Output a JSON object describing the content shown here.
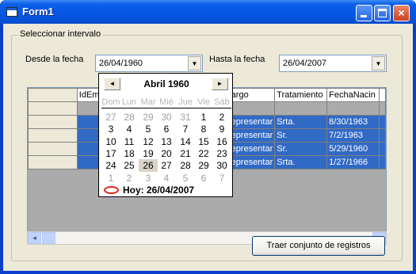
{
  "window": {
    "title": "Form1",
    "minimize": "_",
    "maximize": "□",
    "close": "×"
  },
  "group": {
    "legend": "Seleccionar intervalo"
  },
  "from": {
    "label": "Desde la fecha",
    "value": "26/04/1960",
    "arrow": "▼"
  },
  "to": {
    "label": "Hasta la fecha",
    "value": "26/04/2007",
    "arrow": "▼"
  },
  "grid": {
    "columns": [
      "IdEm",
      "Cargo",
      "Tratamiento",
      "FechaNacin"
    ],
    "rows": [
      {
        "cargo": "Representar",
        "trat": "Srta.",
        "fecha": "8/30/1963"
      },
      {
        "cargo": "Representar",
        "trat": "Sr.",
        "fecha": "7/2/1963"
      },
      {
        "cargo": "Representar",
        "trat": "Sr.",
        "fecha": "5/29/1960"
      },
      {
        "cargo": "Representar",
        "trat": "Srta.",
        "fecha": "1/27/1966"
      }
    ]
  },
  "scroll": {
    "left": "◄",
    "right": "►"
  },
  "button": {
    "fetch": "Traer conjunto de registros"
  },
  "calendar": {
    "month_label": "Abril 1960",
    "prev": "◄",
    "next": "►",
    "weekdays": [
      "Dom",
      "Lun",
      "Mar",
      "Mié",
      "Jue",
      "Vie",
      "Sáb"
    ],
    "weeks": [
      [
        {
          "d": "27",
          "o": true
        },
        {
          "d": "28",
          "o": true
        },
        {
          "d": "29",
          "o": true
        },
        {
          "d": "30",
          "o": true
        },
        {
          "d": "31",
          "o": true
        },
        {
          "d": "1"
        },
        {
          "d": "2"
        }
      ],
      [
        {
          "d": "3"
        },
        {
          "d": "4"
        },
        {
          "d": "5"
        },
        {
          "d": "6"
        },
        {
          "d": "7"
        },
        {
          "d": "8"
        },
        {
          "d": "9"
        }
      ],
      [
        {
          "d": "10"
        },
        {
          "d": "11"
        },
        {
          "d": "12"
        },
        {
          "d": "13"
        },
        {
          "d": "14"
        },
        {
          "d": "15"
        },
        {
          "d": "16"
        }
      ],
      [
        {
          "d": "17"
        },
        {
          "d": "18"
        },
        {
          "d": "19"
        },
        {
          "d": "20"
        },
        {
          "d": "21"
        },
        {
          "d": "22"
        },
        {
          "d": "23"
        }
      ],
      [
        {
          "d": "24"
        },
        {
          "d": "25"
        },
        {
          "d": "26",
          "s": true
        },
        {
          "d": "27"
        },
        {
          "d": "28"
        },
        {
          "d": "29"
        },
        {
          "d": "30"
        }
      ],
      [
        {
          "d": "1",
          "o": true
        },
        {
          "d": "2",
          "o": true
        },
        {
          "d": "3",
          "o": true
        },
        {
          "d": "4",
          "o": true
        },
        {
          "d": "5",
          "o": true
        },
        {
          "d": "6",
          "o": true
        },
        {
          "d": "7",
          "o": true
        }
      ]
    ],
    "today_label": "Hoy: 26/04/2007"
  }
}
